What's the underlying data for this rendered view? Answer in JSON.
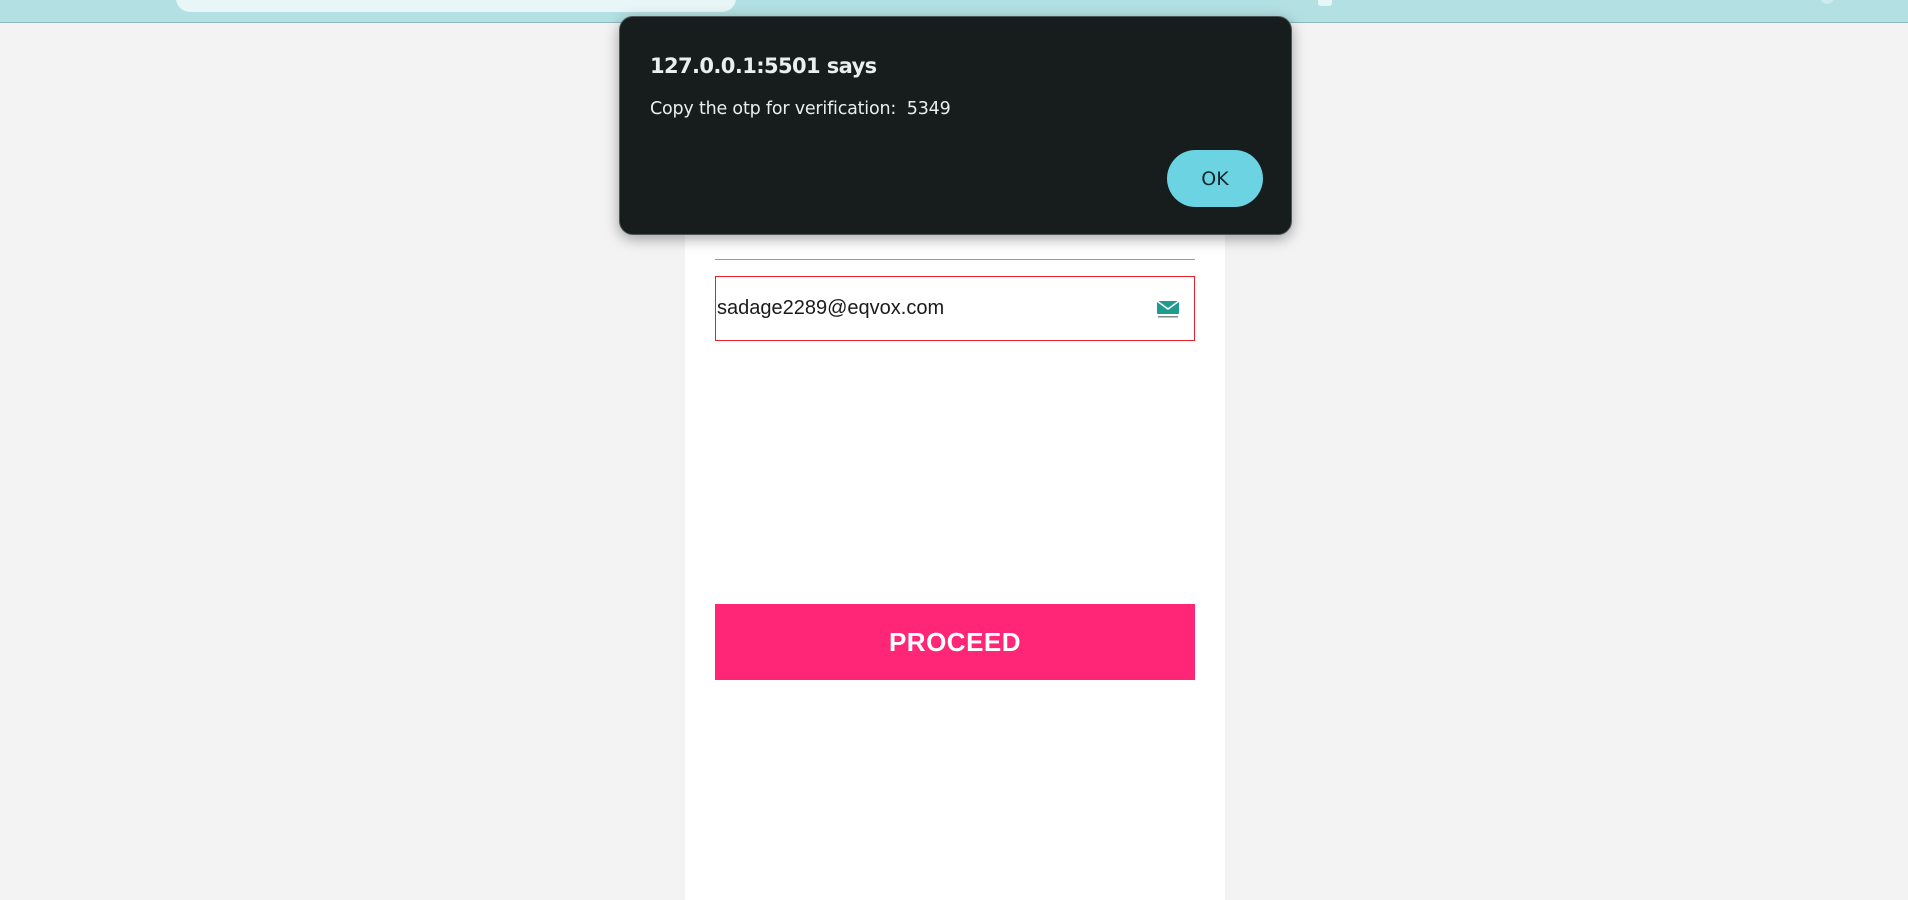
{
  "dialog": {
    "title": "127.0.0.1:5501 says",
    "message": "Copy the otp for verification:  5349",
    "ok_label": "OK"
  },
  "form": {
    "email_value": "sadage2289@eqvox.com",
    "email_icon": "mail-icon",
    "proceed_label": "PROCEED"
  },
  "colors": {
    "dialog_background": "#171d1d",
    "ok_button": "#6cd3e2",
    "proceed_button": "#ff2677",
    "email_border": "#e81f2a",
    "browser_chrome": "#b3e0e3",
    "page_background": "#f3f3f3"
  }
}
